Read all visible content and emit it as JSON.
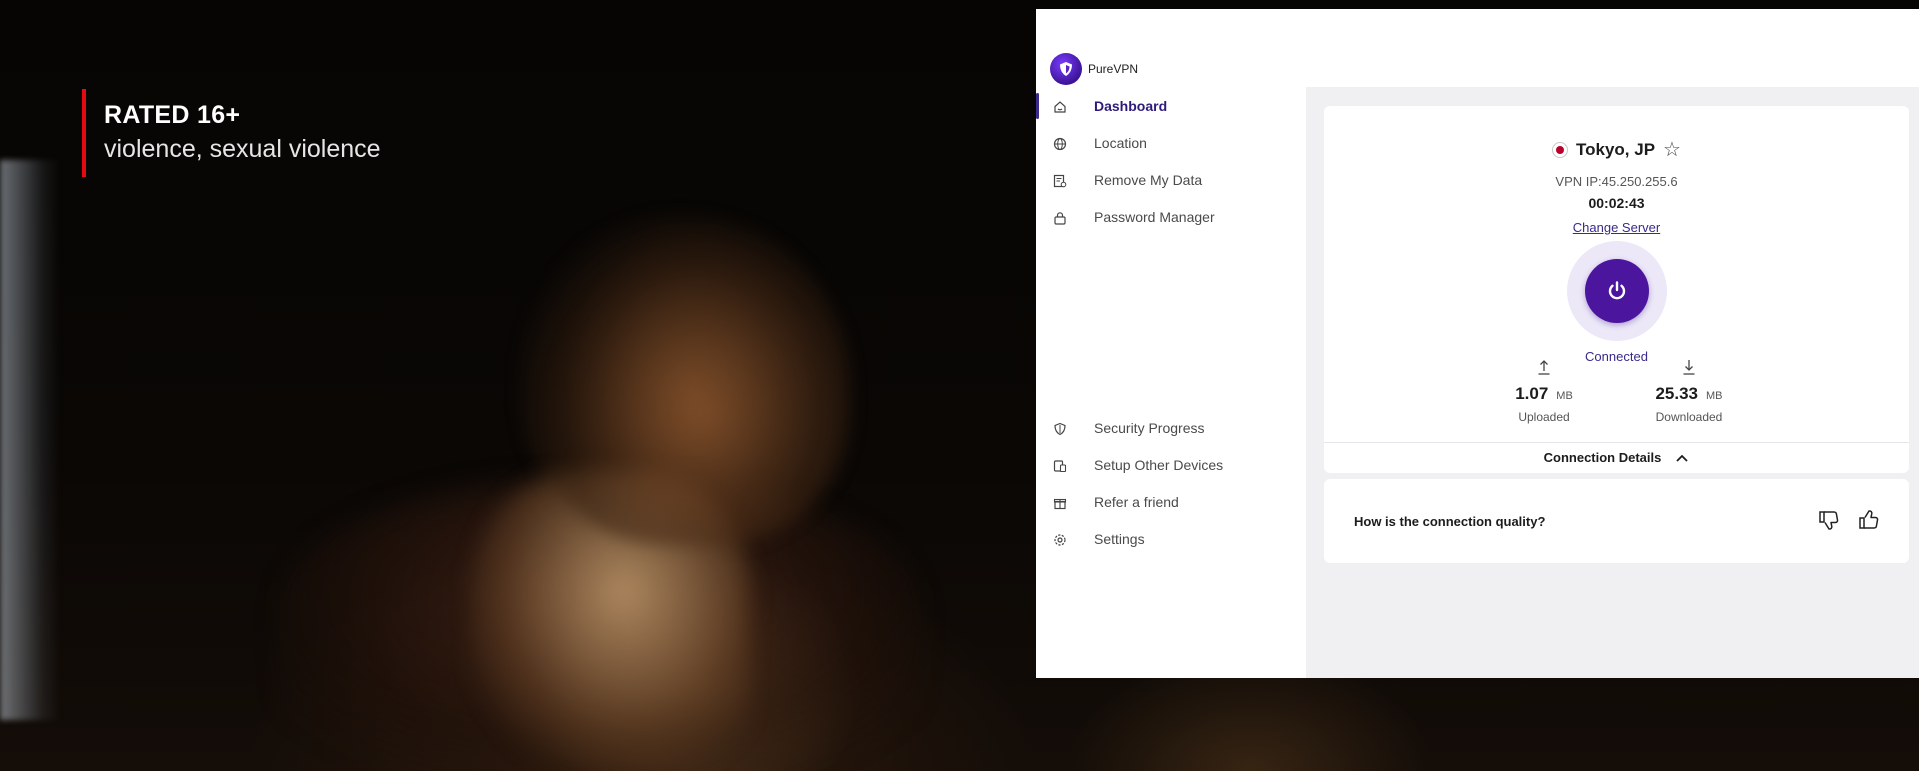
{
  "overlay": {
    "rating_title": "RATED 16+",
    "rating_description": "violence, sexual violence",
    "accent_color": "#e50914"
  },
  "app": {
    "name": "PureVPN",
    "brand_color": "#4b159e"
  },
  "sidebar": {
    "items": [
      {
        "label": "Dashboard",
        "icon": "home-icon",
        "active": true
      },
      {
        "label": "Location",
        "icon": "globe-icon",
        "active": false
      },
      {
        "label": "Remove My Data",
        "icon": "data-removal-icon",
        "active": false
      },
      {
        "label": "Password Manager",
        "icon": "lock-icon",
        "active": false
      },
      {
        "label": "Security Progress",
        "icon": "shield-icon",
        "active": false
      },
      {
        "label": "Setup Other Devices",
        "icon": "devices-icon",
        "active": false
      },
      {
        "label": "Refer a friend",
        "icon": "gift-icon",
        "active": false
      },
      {
        "label": "Settings",
        "icon": "gear-icon",
        "active": false
      }
    ]
  },
  "connection": {
    "server": "Tokyo, JP",
    "vpn_ip": "VPN IP:45.250.255.6",
    "elapsed": "00:02:43",
    "change_server_label": "Change Server",
    "status": "Connected",
    "uploaded": {
      "value": "1.07",
      "unit": "MB",
      "label": "Uploaded"
    },
    "downloaded": {
      "value": "25.33",
      "unit": "MB",
      "label": "Downloaded"
    },
    "details_label": "Connection Details"
  },
  "feedback": {
    "question": "How is the connection quality?"
  }
}
